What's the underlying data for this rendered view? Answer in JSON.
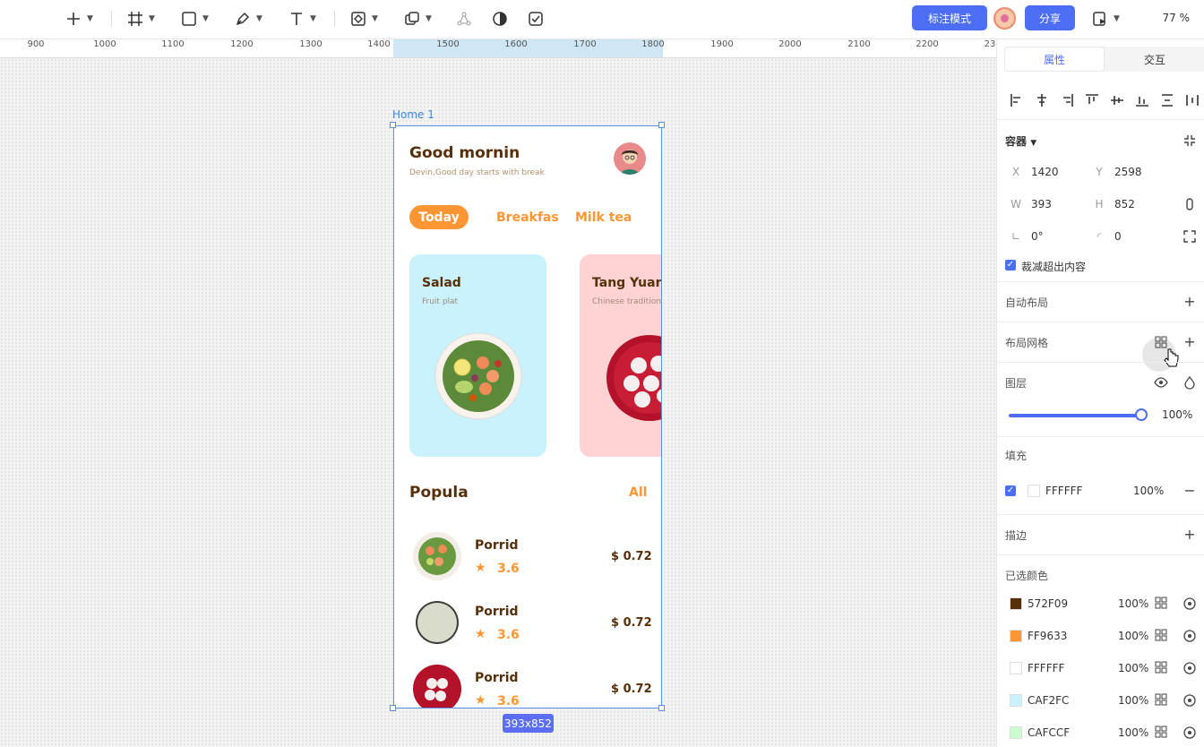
{
  "toolbar": {
    "share_label": "分享",
    "annotate_label": "标注模式",
    "zoom_label": "77 %"
  },
  "ruler": {
    "ticks": [
      "900",
      "1000",
      "1100",
      "1200",
      "1300",
      "1400",
      "1500",
      "1600",
      "1700",
      "1800",
      "1900",
      "2000",
      "2100",
      "2200",
      "23"
    ]
  },
  "canvas": {
    "frame_name": "Home 1",
    "size_badge": "393x852"
  },
  "app": {
    "greeting": "Good mornin",
    "greeting_sub": "Devin,Good day starts with break",
    "tabs": [
      "Today",
      "Breakfas",
      "Milk tea"
    ],
    "cards": [
      {
        "title": "Salad",
        "subtitle": "Fruit plat",
        "bg": "#CAF2FC"
      },
      {
        "title": "Tang Yuan",
        "subtitle": "Chinese traditiona",
        "bg": "#FFD3D3"
      }
    ],
    "section_title": "Popula",
    "section_link": "All",
    "items": [
      {
        "name": "Porrid",
        "rating": "3.6",
        "price": "$ 0.72"
      },
      {
        "name": "Porrid",
        "rating": "3.6",
        "price": "$ 0.72"
      },
      {
        "name": "Porrid",
        "rating": "3.6",
        "price": "$ 0.72"
      }
    ]
  },
  "panel": {
    "tabs": [
      "属性",
      "交互"
    ],
    "container_label": "容器",
    "x_key": "X",
    "x_value": "1420",
    "y_key": "Y",
    "y_value": "2598",
    "w_key": "W",
    "w_value": "393",
    "h_key": "H",
    "h_value": "852",
    "rotation_value": "0°",
    "radius_value": "0",
    "clip_label": "裁减超出内容",
    "auto_layout_label": "自动布局",
    "layout_grid_label": "布局网格",
    "layer_label": "图层",
    "opacity_value": "100%",
    "fill_label": "填充",
    "fill_hex": "FFFFFF",
    "fill_pct": "100%",
    "stroke_label": "描边",
    "selected_colors_label": "已选颜色",
    "selected_colors": [
      {
        "hex": "572F09",
        "pct": "100%",
        "color": "#572F09"
      },
      {
        "hex": "FF9633",
        "pct": "100%",
        "color": "#FF9633"
      },
      {
        "hex": "FFFFFF",
        "pct": "100%",
        "color": "#FFFFFF"
      },
      {
        "hex": "CAF2FC",
        "pct": "100%",
        "color": "#CAF2FC"
      },
      {
        "hex": "CAFCCF",
        "pct": "100%",
        "color": "#CAFCCF"
      }
    ]
  }
}
